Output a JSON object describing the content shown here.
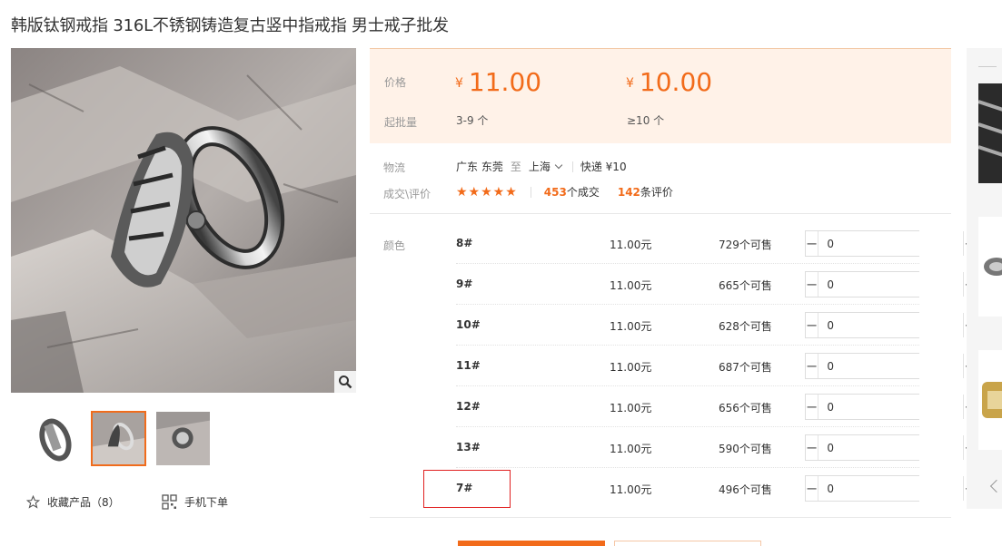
{
  "product": {
    "title": "韩版钛钢戒指 316L不锈钢铸造复古竖中指戒指 男士戒子批发"
  },
  "gallery": {
    "favorite_label": "收藏产品（8）",
    "mobile_label": "手机下单"
  },
  "price_box": {
    "price_label": "价格",
    "moq_label": "起批量",
    "tiers": [
      {
        "currency": "¥",
        "price": "11.00",
        "range": "3-9 个"
      },
      {
        "currency": "¥",
        "price": "10.00",
        "range": "≥10 个"
      }
    ]
  },
  "logistics": {
    "label": "物流",
    "from": "广东 东莞",
    "to_word": "至",
    "to": "上海",
    "express": "快递 ¥10"
  },
  "reviews": {
    "label": "成交\\评价",
    "stars": "★★★★★",
    "deals_count": "453",
    "deals_suffix": "个成交",
    "review_count": "142",
    "review_suffix": "条评价"
  },
  "sku": {
    "label": "颜色",
    "rows": [
      {
        "name": "8#",
        "price": "11.00元",
        "stock": "729个可售",
        "qty": "0"
      },
      {
        "name": "9#",
        "price": "11.00元",
        "stock": "665个可售",
        "qty": "0"
      },
      {
        "name": "10#",
        "price": "11.00元",
        "stock": "628个可售",
        "qty": "0"
      },
      {
        "name": "11#",
        "price": "11.00元",
        "stock": "687个可售",
        "qty": "0"
      },
      {
        "name": "12#",
        "price": "11.00元",
        "stock": "656个可售",
        "qty": "0"
      },
      {
        "name": "13#",
        "price": "11.00元",
        "stock": "590个可售",
        "qty": "0"
      },
      {
        "name": "7#",
        "price": "11.00元",
        "stock": "496个可售",
        "qty": "0"
      }
    ],
    "minus": "−",
    "plus": "+"
  },
  "icons": {
    "zoom": "search-icon",
    "favorite": "star-outline-icon",
    "mobile": "qr-code-icon",
    "rail_prev": "chevron-left-icon"
  },
  "colors": {
    "accent": "#f26b1a",
    "price_bg": "#fff2e8",
    "highlight": "#e02020"
  }
}
